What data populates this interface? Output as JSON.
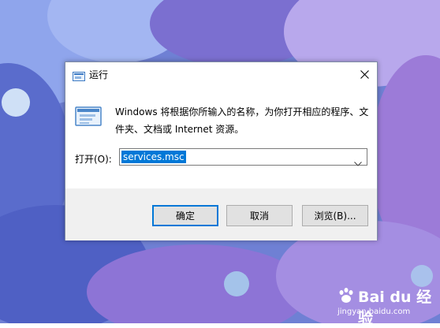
{
  "wallpaper": {
    "colors": [
      "#6b82d6",
      "#8ea3ea",
      "#4d5dc0",
      "#b2a5e8",
      "#9063c8",
      "#3d4aa8"
    ]
  },
  "dialog": {
    "title": "运行",
    "title_icon": "run-icon",
    "close_icon": "close-icon",
    "description": "Windows 将根据你所输入的名称，为你打开相应的程序、文件夹、文档或 Internet 资源。",
    "open_label": "打开(O):",
    "input_value": "services.msc",
    "buttons": {
      "ok": "确定",
      "cancel": "取消",
      "browse": "浏览(B)..."
    }
  },
  "watermark": {
    "brand": "Bai du 经验",
    "url": "jingyan.baidu.com"
  },
  "colors": {
    "accent": "#0078d7",
    "footer_bg": "#f0f0f0",
    "button_bg": "#e1e1e1"
  }
}
